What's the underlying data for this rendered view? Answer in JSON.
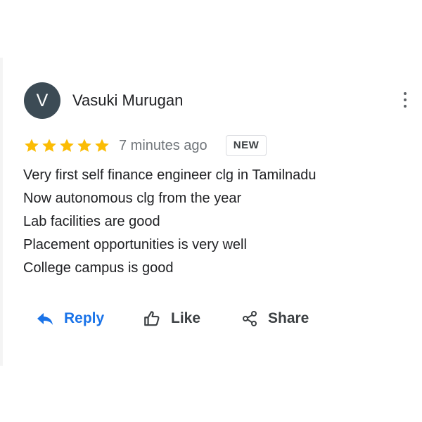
{
  "review": {
    "avatar_letter": "V",
    "author": "Vasuki Murugan",
    "rating": 5,
    "rating_max": 5,
    "time": "7 minutes ago",
    "badge": "NEW",
    "lines": [
      "Very first self finance engineer clg in Tamilnadu",
      "Now autonomous clg from the year",
      "Lab facilities are good",
      "Placement opportunities is very well",
      "College campus is good"
    ]
  },
  "actions": {
    "reply": "Reply",
    "like": "Like",
    "share": "Share"
  },
  "icons": {
    "more": "more-vert-icon",
    "star": "star-icon",
    "reply": "reply-icon",
    "like": "thumb-up-icon",
    "share": "share-icon"
  },
  "colors": {
    "star": "#fbbc04",
    "accent": "#1a73e8",
    "avatar_bg": "#3c4b55",
    "text": "#202124",
    "muted": "#70757a"
  }
}
